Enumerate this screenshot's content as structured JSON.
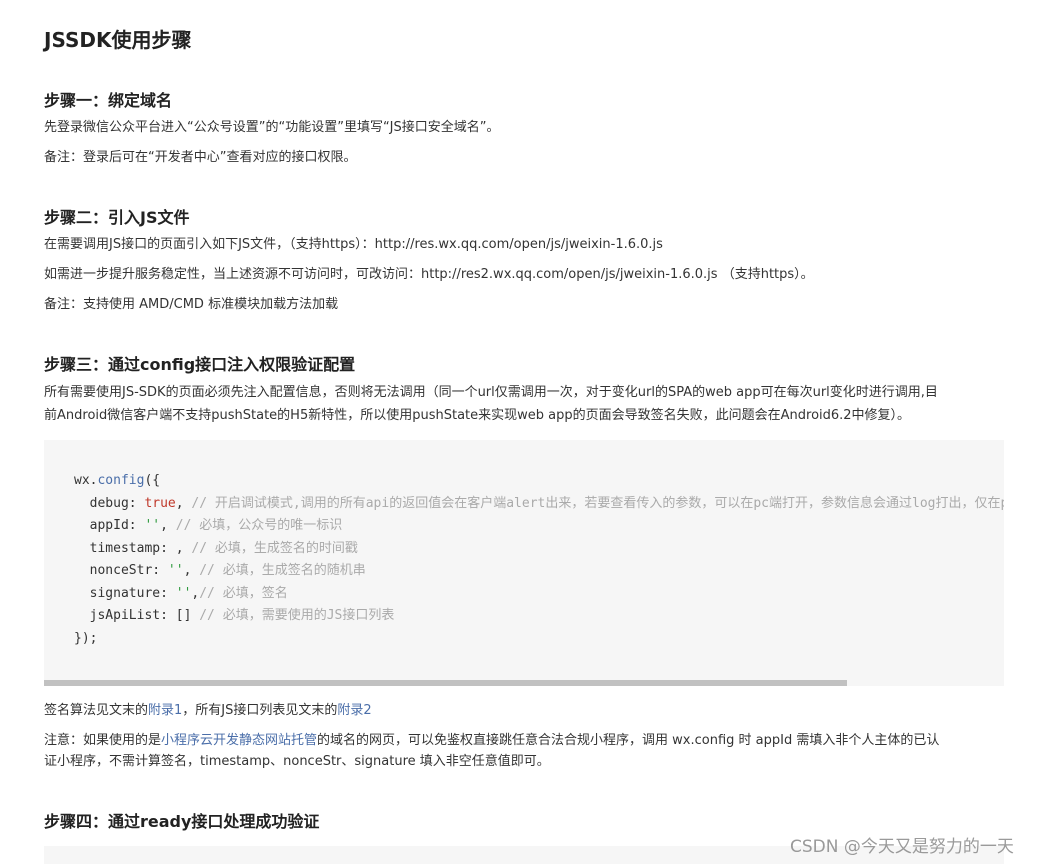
{
  "title": "JSSDK使用步骤",
  "step1": {
    "heading": "步骤一：绑定域名",
    "line1": "先登录微信公众平台进入“公众号设置”的“功能设置”里填写“JS接口安全域名”。",
    "line2": "备注：登录后可在“开发者中心”查看对应的接口权限。"
  },
  "step2": {
    "heading": "步骤二：引入JS文件",
    "line1": "在需要调用JS接口的页面引入如下JS文件，（支持https）：http://res.wx.qq.com/open/js/jweixin-1.6.0.js",
    "line2": "如需进一步提升服务稳定性，当上述资源不可访问时，可改访问：http://res2.wx.qq.com/open/js/jweixin-1.6.0.js （支持https）。",
    "line3": "备注：支持使用 AMD/CMD 标准模块加载方法加载"
  },
  "step3": {
    "heading": "步骤三：通过config接口注入权限验证配置",
    "para1": "所有需要使用JS-SDK的页面必须先注入配置信息，否则将无法调用（同一个url仅需调用一次，对于变化url的SPA的web app可在每次url变化时进行调用,目",
    "para2": "前Android微信客户端不支持pushState的H5新特性，所以使用pushState来实现web app的页面会导致签名失败，此问题会在Android6.2中修复）。",
    "code": {
      "l1_obj": "wx.",
      "l1_fn": "config",
      "l1_end": "({",
      "l2_key": "  debug: ",
      "l2_val": "true",
      "l2_sep": ", ",
      "l2_cm": "// 开启调试模式,调用的所有api的返回值会在客户端alert出来，若要查看传入的参数，可以在pc端打开，参数信息会通过log打出，仅在pc端时才会打印。",
      "l3_key": "  appId: ",
      "l3_val": "''",
      "l3_sep": ", ",
      "l3_cm": "// 必填，公众号的唯一标识",
      "l4_key": "  timestamp: , ",
      "l4_cm": "// 必填，生成签名的时间戳",
      "l5_key": "  nonceStr: ",
      "l5_val": "''",
      "l5_sep": ", ",
      "l5_cm": "// 必填，生成签名的随机串",
      "l6_key": "  signature: ",
      "l6_val": "''",
      "l6_sep": ",",
      "l6_cm": "// 必填，签名",
      "l7_key": "  jsApiList: [] ",
      "l7_cm": "// 必填，需要使用的JS接口列表",
      "l8": "});"
    },
    "after1_a": "签名算法见文末的",
    "after1_link1": "附录1",
    "after1_b": "，所有JS接口列表见文末的",
    "after1_link2": "附录2",
    "note_a": "注意：如果使用的是",
    "note_link": "小程序云开发静态网站托管",
    "note_b": "的域名的网页，可以免鉴权直接跳任意合法合规小程序，调用 wx.config 时 appId 需填入非个人主体的已认",
    "note_line2": "证小程序，不需计算签名，timestamp、nonceStr、signature 填入非空任意值即可。"
  },
  "step4": {
    "heading": "步骤四：通过ready接口处理成功验证"
  },
  "watermark": "CSDN @今天又是努力的一天"
}
